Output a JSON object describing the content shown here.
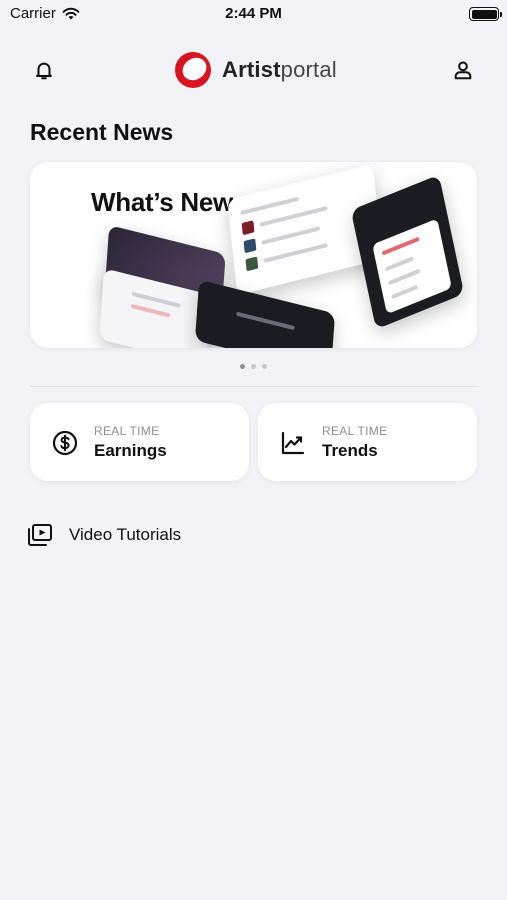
{
  "status_bar": {
    "carrier": "Carrier",
    "time": "2:44 PM",
    "battery_level": 1.0
  },
  "header": {
    "logo_bold": "Artist",
    "logo_light": "portal",
    "brand_color": "#d7141f",
    "left_icon": "bell-icon",
    "right_icon": "user-icon"
  },
  "recent_news": {
    "title": "Recent News",
    "carousel": {
      "slide_title": "What’s New",
      "slide_count": 3,
      "active_slide": 1
    }
  },
  "cards": [
    {
      "kicker": "REAL TIME",
      "label": "Earnings",
      "icon": "dollar-circle-icon"
    },
    {
      "kicker": "REAL TIME",
      "label": "Trends",
      "icon": "trend-chart-icon"
    }
  ],
  "video_tutorials": {
    "label": "Video Tutorials",
    "icon": "video-library-icon"
  },
  "colors": {
    "background": "#f2f2f7",
    "card": "#ffffff",
    "text": "#111111",
    "muted": "#8e8e93"
  }
}
